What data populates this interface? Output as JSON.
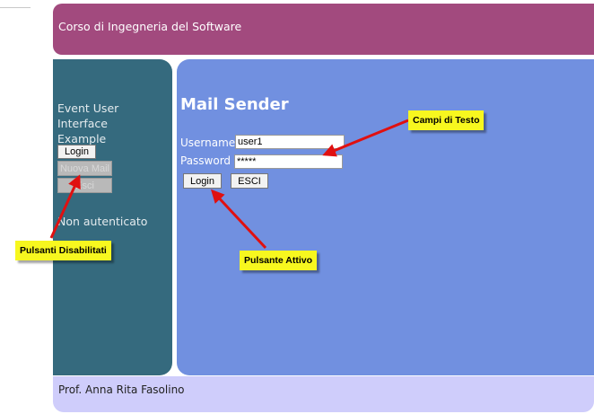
{
  "header": {
    "title": "Corso di Ingegneria del Software"
  },
  "sidebar": {
    "title_line1": "Event User Interface",
    "title_line2": "Example",
    "buttons": {
      "login": "Login",
      "nuova_mail": "Nuova Mail",
      "esci": "Esci"
    },
    "status": "Non autenticato"
  },
  "main": {
    "title": "Mail Sender",
    "username_label": "Username",
    "username_value": "user1",
    "password_label": "Password",
    "password_value": "*****",
    "login_button": "Login",
    "esci_button": "ESCI"
  },
  "callouts": {
    "campi_testo": "Campi di Testo",
    "pulsanti_disabilitati": "Pulsanti Disabilitati",
    "pulsante_attivo": "Pulsante Attivo"
  },
  "footer": {
    "text": "Prof. Anna Rita Fasolino"
  },
  "colors": {
    "header": "#a24a7e",
    "sidebar": "#356a7e",
    "main": "#7190e0",
    "footer": "#cfcdfb",
    "callout": "#f7f71f",
    "arrow": "#e01010"
  }
}
